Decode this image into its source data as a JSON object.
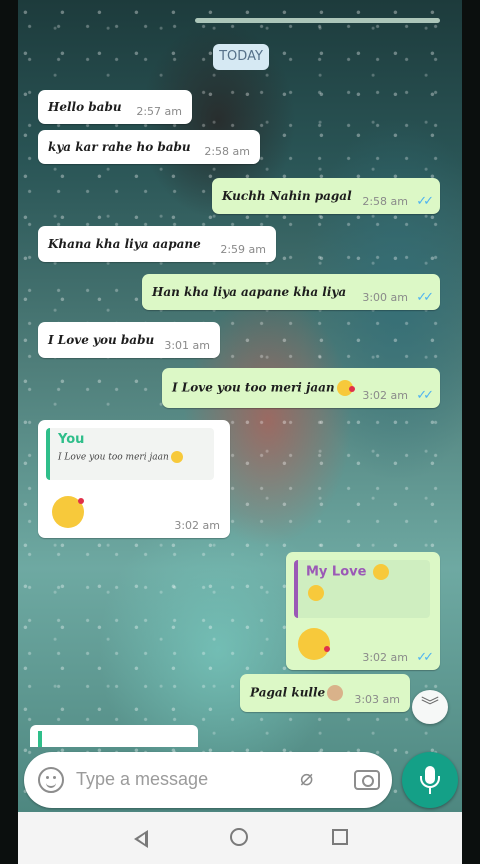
{
  "chat": {
    "date_label": "TODAY",
    "messages": [
      {
        "dir": "in",
        "text": "Hello babu",
        "time": "2:57 am"
      },
      {
        "dir": "in",
        "text": "kya kar rahe ho babu",
        "time": "2:58 am"
      },
      {
        "dir": "out",
        "text": "Kuchh Nahin pagal",
        "time": "2:58 am"
      },
      {
        "dir": "in",
        "text": "Khana kha liya aapane",
        "time": "2:59 am"
      },
      {
        "dir": "out",
        "text": "Han kha liya aapane kha liya",
        "time": "3:00 am"
      },
      {
        "dir": "in",
        "text": "I Love you babu",
        "time": "3:01 am"
      },
      {
        "dir": "out",
        "text": "I Love you too meri jaan",
        "time": "3:02 am"
      },
      {
        "dir": "in",
        "reply_name": "You",
        "reply_text": "I Love you too meri jaan",
        "time": "3:02 am"
      },
      {
        "dir": "out",
        "reply_name": "My Love",
        "time": "3:02 am"
      },
      {
        "dir": "out",
        "text": "Pagal kulle",
        "time": "3:03 am"
      }
    ],
    "tick_glyph": "✓✓"
  },
  "composer": {
    "placeholder": "Type a message",
    "icons": [
      "emoji-icon",
      "paperclip-icon",
      "camera-icon",
      "mic-icon"
    ]
  },
  "nav": {
    "icons": [
      "back-icon",
      "home-icon",
      "recents-icon"
    ]
  },
  "colors": {
    "incoming": "#ffffff",
    "outgoing": "#dcf8c6",
    "accent": "#14a087",
    "read_ticks": "#4fb3f0"
  }
}
